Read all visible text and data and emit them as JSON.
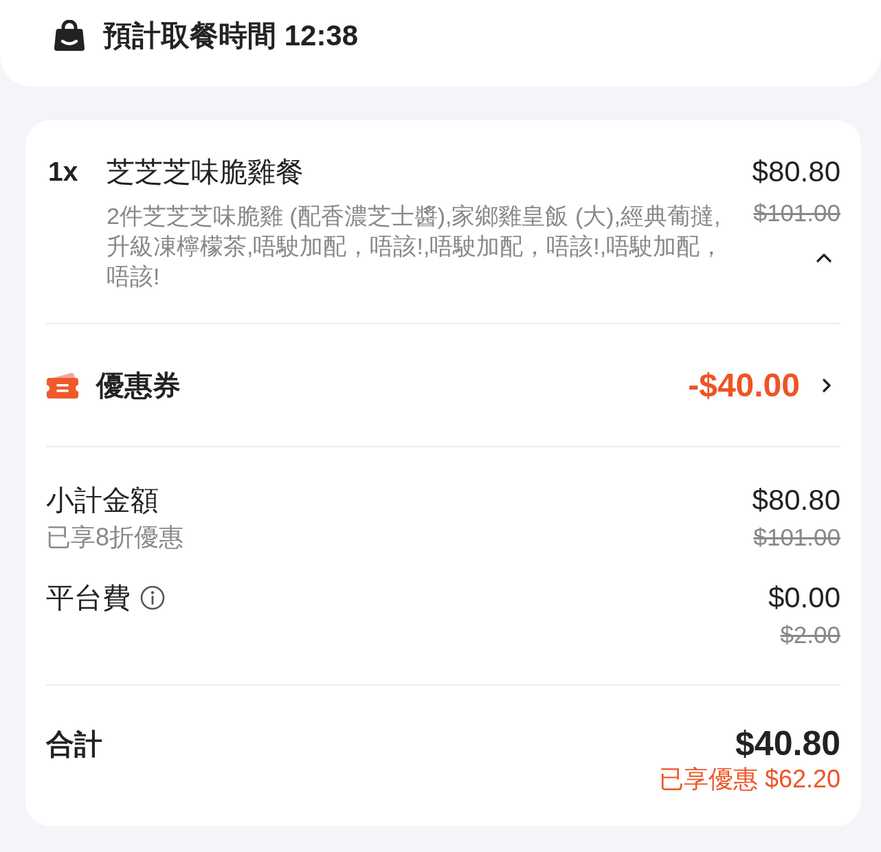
{
  "header": {
    "title": "預計取餐時間 12:38"
  },
  "order_item": {
    "quantity": "1x",
    "name": "芝芝芝味脆雞餐",
    "price": "$80.80",
    "original_price": "$101.00",
    "description": "2件芝芝芝味脆雞 (配香濃芝士醬),家鄉雞皇飯 (大),經典葡撻,升級凍檸檬茶,唔駛加配，唔該!,唔駛加配，唔該!,唔駛加配，唔該!",
    "expanded": true
  },
  "coupon": {
    "label": "優惠券",
    "amount": "-$40.00"
  },
  "summary": [
    {
      "label": "小計金額",
      "note": "已享8折優惠",
      "info": false,
      "price": "$80.80",
      "original_price": "$101.00"
    },
    {
      "label": "平台費",
      "info": true,
      "price": "$0.00",
      "original_price": "$2.00"
    }
  ],
  "total": {
    "label": "合計",
    "amount": "$40.80",
    "savings": "已享優惠 $62.20"
  }
}
